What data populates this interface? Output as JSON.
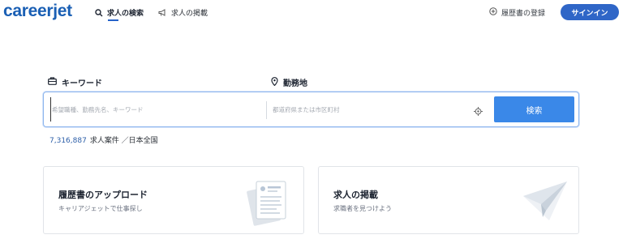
{
  "header": {
    "logo": "careerjet",
    "nav": [
      {
        "label": "求人の検索",
        "icon": "search-icon",
        "active": true
      },
      {
        "label": "求人の掲載",
        "icon": "megaphone-icon",
        "active": false
      }
    ],
    "resume_link": "履歴書の登録",
    "signin": "サインイン"
  },
  "search": {
    "keyword_label": "キーワード",
    "location_label": "勤務地",
    "keyword_placeholder": "希望職種、勤務先名、キーワード",
    "location_placeholder": "都道府県または市区町村",
    "button": "検索"
  },
  "stats": {
    "count": "7,316,887",
    "suffix": "求人案件 ／日本全国"
  },
  "cards": [
    {
      "title": "履歴書のアップロード",
      "subtitle": "キャリアジェットで仕事探し",
      "icon": "resume-document-icon"
    },
    {
      "title": "求人の掲載",
      "subtitle": "求職者を見つけよう",
      "icon": "paper-plane-icon"
    }
  ],
  "colors": {
    "brand": "#1a5fb4",
    "accent": "#2f66c7",
    "search_button": "#3a88e8"
  }
}
